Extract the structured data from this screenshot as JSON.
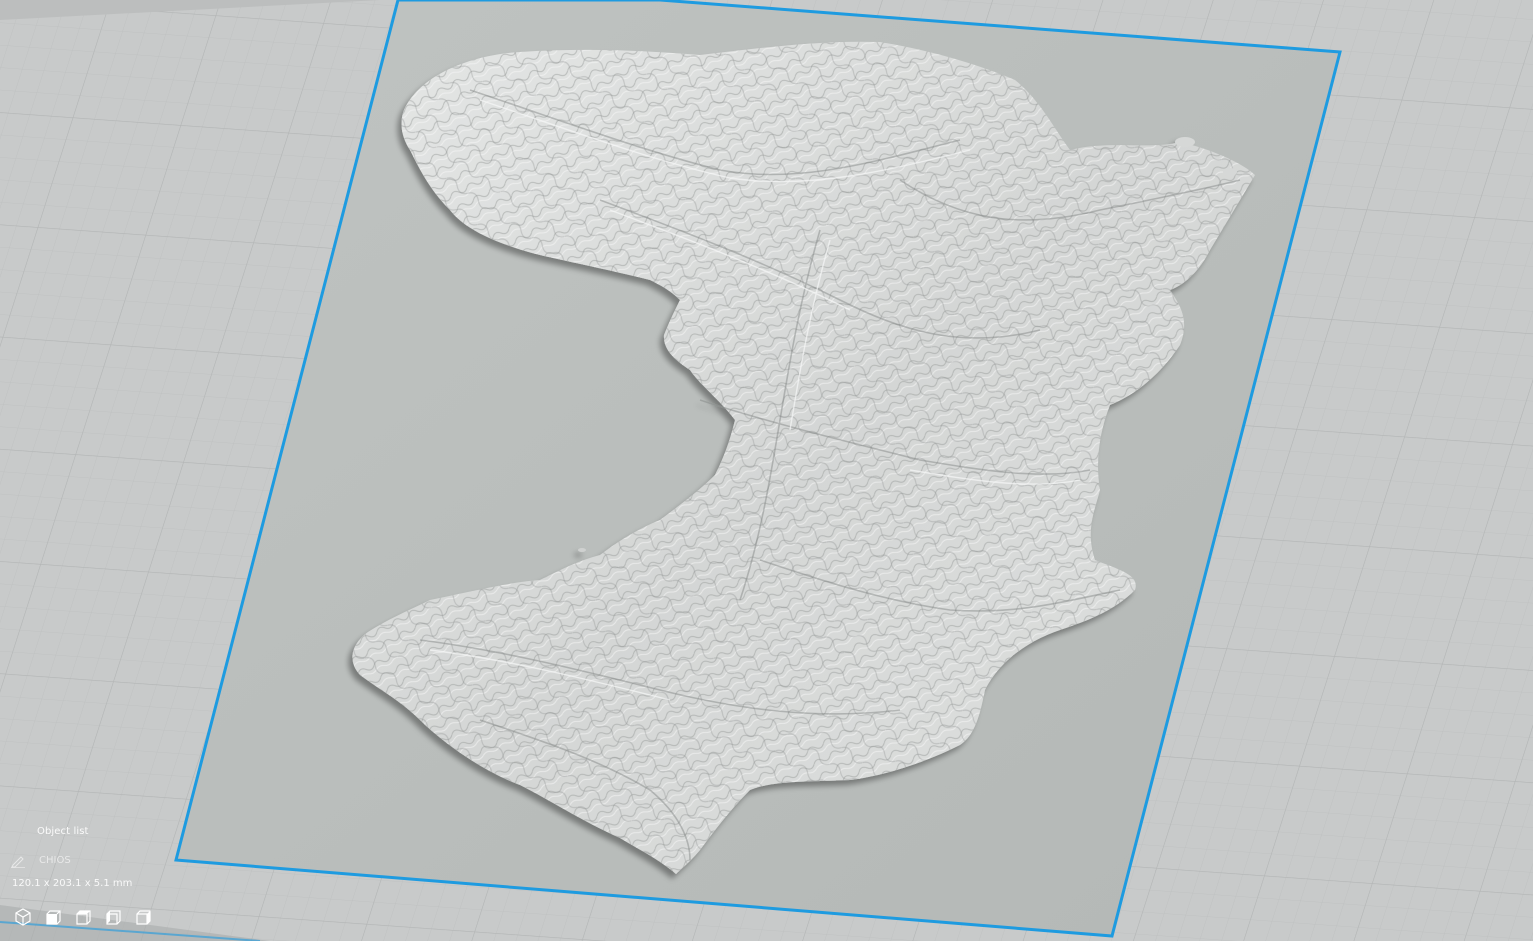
{
  "object_list": {
    "title": "Object list",
    "items": [
      {
        "name": "CHIOS",
        "icon": "pencil-icon"
      }
    ],
    "dimensions": "120.1 x 203.1 x 5.1 mm"
  },
  "view_toolbar": {
    "buttons": [
      {
        "name": "view-3d-button",
        "icon": "cube-3d-icon"
      },
      {
        "name": "view-front-button",
        "icon": "cube-front-icon"
      },
      {
        "name": "view-top-button",
        "icon": "cube-top-icon"
      },
      {
        "name": "view-left-button",
        "icon": "cube-left-icon"
      },
      {
        "name": "view-right-button",
        "icon": "cube-right-icon"
      }
    ]
  },
  "colors": {
    "background": "#c9cbcb",
    "grid_line": "#b6b8b8",
    "plate": "#b9bdbb",
    "selection_outline": "#1e9be0",
    "terrain": "#dcdedd",
    "terrain_shadow": "#8e9291",
    "ui_text": "#ffffff"
  }
}
